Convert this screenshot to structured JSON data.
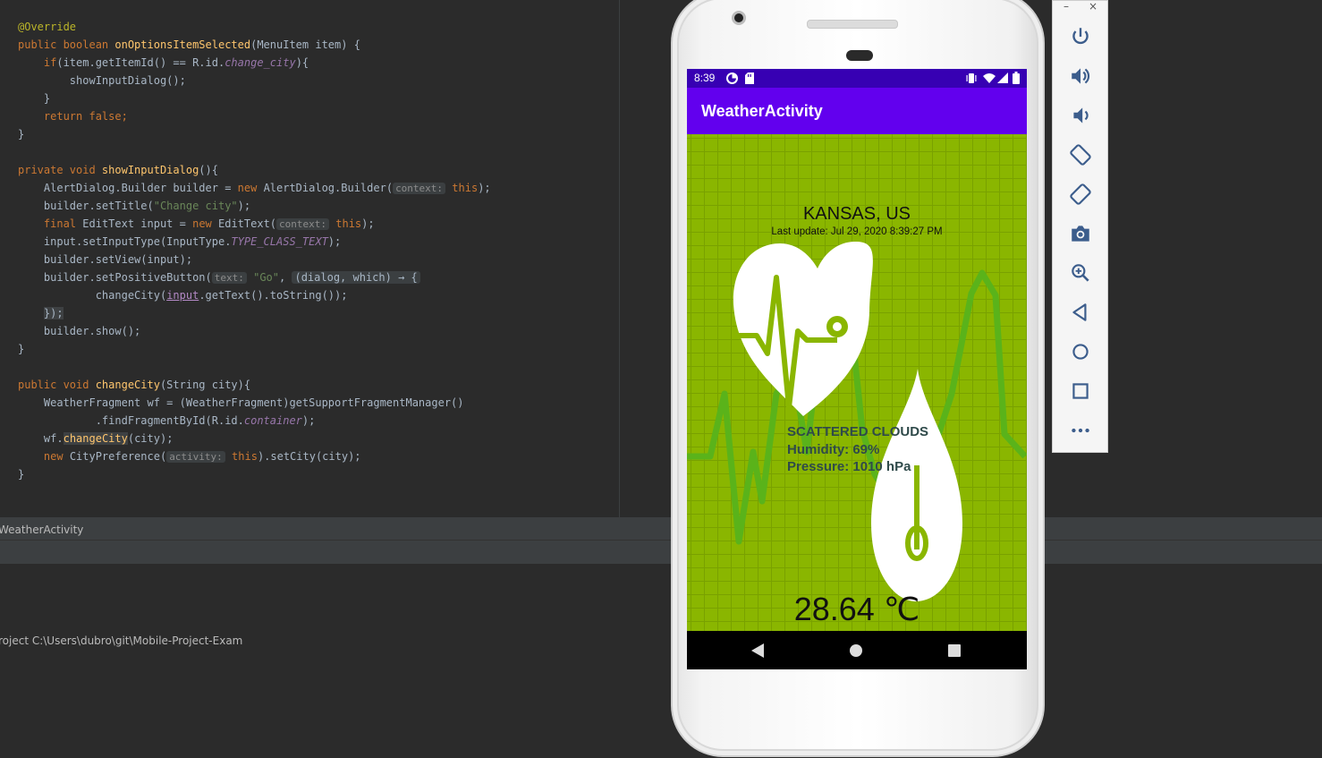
{
  "editor": {
    "lines": {
      "l1": "@Override",
      "l2a": "public boolean ",
      "l2b": "onOptionsItemSelected",
      "l2c": "(MenuItem item) {",
      "l3a": "if",
      "l3b": "(item.getItemId() == R.id.",
      "l3c": "change_city",
      "l3d": "){",
      "l4": "showInputDialog();",
      "l5": "}",
      "l6a": "return false",
      "l6b": ";",
      "l7": "}",
      "l8a": "private void ",
      "l8b": "showInputDialog",
      "l8c": "(){",
      "l9a": "AlertDialog.Builder builder = ",
      "l9b": "new ",
      "l9c": "AlertDialog.Builder(",
      "l9d": "context:",
      "l9e": "this",
      "l9f": ");",
      "l10a": "builder.setTitle(",
      "l10b": "\"Change city\"",
      "l10c": ");",
      "l11a": "final ",
      "l11b": "EditText input = ",
      "l11c": "new ",
      "l11d": "EditText(",
      "l11e": "context:",
      "l11f": "this",
      "l11g": ");",
      "l12a": "input.setInputType(InputType.",
      "l12b": "TYPE_CLASS_TEXT",
      "l12c": ");",
      "l13": "builder.setView(input);",
      "l14a": "builder.setPositiveButton(",
      "l14b": "text:",
      "l14c": "\"Go\"",
      "l14d": ", ",
      "l14e": "(dialog, which) → {",
      "l15a": "changeCity(",
      "l15b": "input",
      "l15c": ".getText().toString());",
      "l16": "});",
      "l17": "builder.show();",
      "l18": "}",
      "l19a": "public void ",
      "l19b": "changeCity",
      "l19c": "(String city){",
      "l20": "WeatherFragment wf = (WeatherFragment)getSupportFragmentManager()",
      "l21a": ".findFragmentById(R.id.",
      "l21b": "container",
      "l21c": ");",
      "l22a": "wf.",
      "l22b": "changeCity",
      "l22c": "(city);",
      "l23a": "new ",
      "l23b": "CityPreference(",
      "l23c": "activity:",
      "l23d": "this",
      "l23e": ").setCity(city);",
      "l24": "}"
    }
  },
  "bottom_panel": {
    "run_tab": "WeatherActivity",
    "console_text": "roject C:\\Users\\dubro\\git\\Mobile-Project-Exam"
  },
  "phone": {
    "status_time": "8:39",
    "app_title": "WeatherActivity",
    "city": "KANSAS, US",
    "last_update": "Last update: Jul 29, 2020 8:39:27 PM",
    "weather_details": {
      "description": "SCATTERED CLOUDS",
      "humidity": "Humidity: 69%",
      "pressure": "Pressure: 1010 hPa"
    },
    "temperature": "28.64 ℃"
  },
  "emulator_toolbar": {
    "minimize": "–",
    "close": "×",
    "buttons": [
      "power-icon",
      "volume-up-icon",
      "volume-down-icon",
      "rotate-left-icon",
      "rotate-right-icon",
      "camera-icon",
      "zoom-icon",
      "back-icon",
      "home-icon",
      "overview-icon",
      "more-icon"
    ]
  },
  "colors": {
    "status_bar": "#3700b3",
    "app_bar": "#6200ee",
    "background": "#8ab600",
    "graphic": "#ffffff",
    "ekg_line": "#5ab31a"
  }
}
